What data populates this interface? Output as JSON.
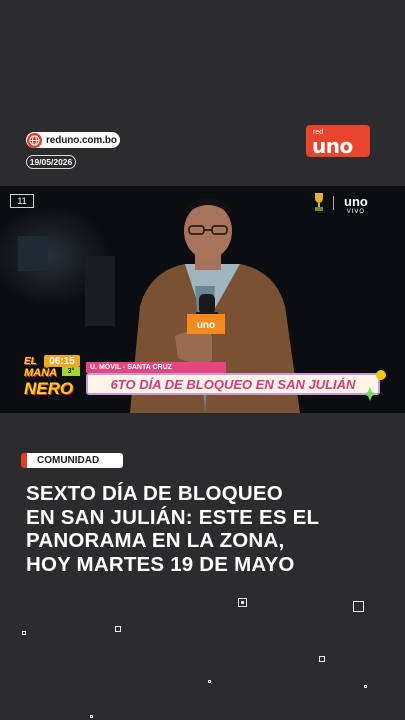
{
  "header": {
    "site": "reduno.com.bo",
    "date": "19/05/2026",
    "logo": {
      "small": "red",
      "main": "uno"
    }
  },
  "video": {
    "channel": "11",
    "live_logo": {
      "main": "uno",
      "sub": "VIVO"
    },
    "show": {
      "line1": "EL",
      "line2": "MAÑA",
      "line3": "NERO"
    },
    "clock": "06:15",
    "temperature": "3°",
    "location": "U. MÓVIL - SANTA CRUZ",
    "headline": "6TO DÍA DE BLOQUEO EN SAN JULIÁN",
    "mic_logo": "uno"
  },
  "article": {
    "category": "COMUNIDAD",
    "title_lines": [
      "SEXTO DÍA DE BLOQUEO",
      "EN SAN JULIÁN: ESTE ES EL",
      "PANORAMA EN LA ZONA,",
      "HOY MARTES 19 DE MAYO"
    ]
  },
  "colors": {
    "background": "#2c2c2e",
    "accent_red": "#e53a2c",
    "headline_pink": "#d9397c"
  }
}
